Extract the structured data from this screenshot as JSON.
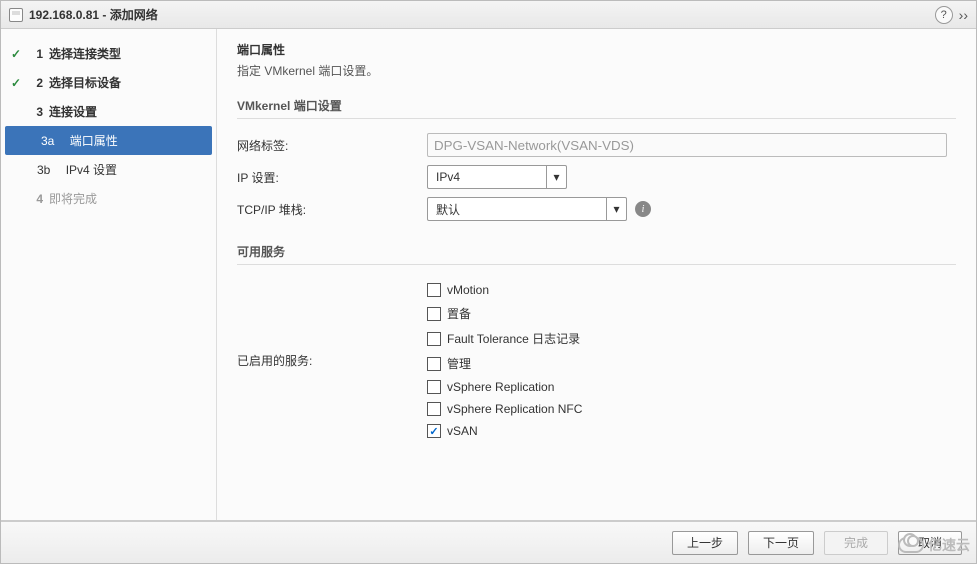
{
  "titlebar": {
    "host": "192.168.0.81",
    "dash": " - ",
    "action": "添加网络"
  },
  "steps": {
    "s1": {
      "num": "1",
      "label": "选择连接类型"
    },
    "s2": {
      "num": "2",
      "label": "选择目标设备"
    },
    "s3": {
      "num": "3",
      "label": "连接设置"
    },
    "s3a": {
      "num": "3a",
      "label": "端口属性"
    },
    "s3b": {
      "num": "3b",
      "label": "IPv4 设置"
    },
    "s4": {
      "num": "4",
      "label": "即将完成"
    }
  },
  "page": {
    "title": "端口属性",
    "desc": "指定 VMkernel 端口设置。"
  },
  "section": {
    "vmk": "VMkernel 端口设置",
    "net_label": "网络标签:",
    "net_value": "DPG-VSAN-Network(VSAN-VDS)",
    "ip_label": "IP 设置:",
    "ip_value": "IPv4",
    "stack_label": "TCP/IP 堆栈:",
    "stack_value": "默认",
    "services": "可用服务",
    "enabled": "已启用的服务:"
  },
  "services": {
    "vmotion": "vMotion",
    "prov": "置备",
    "ft": "Fault Tolerance 日志记录",
    "mgmt": "管理",
    "vr": "vSphere Replication",
    "vrnfc": "vSphere Replication NFC",
    "vsan": "vSAN"
  },
  "checked": {
    "vmotion": false,
    "prov": false,
    "ft": false,
    "mgmt": false,
    "vr": false,
    "vrnfc": false,
    "vsan": true
  },
  "footer": {
    "back": "上一步",
    "next": "下一页",
    "finish": "完成",
    "cancel": "取消"
  },
  "watermark": "亿速云"
}
